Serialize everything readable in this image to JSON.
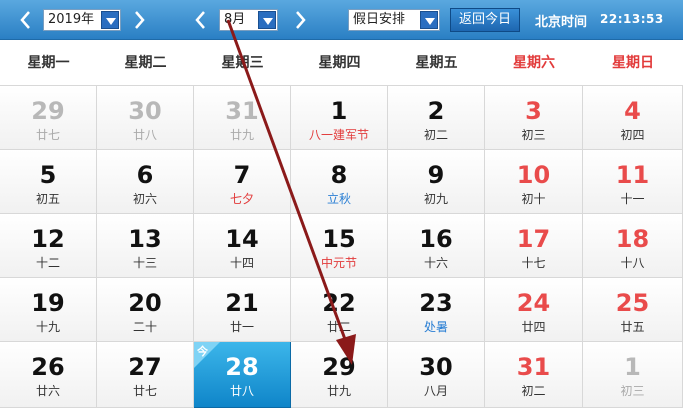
{
  "toolbar": {
    "year_value": "2019年",
    "month_value": "8月",
    "holiday_value": "假日安排",
    "today_button": "返回今日",
    "clock_label": "北京时间",
    "clock_time": "22:13:53"
  },
  "weekdays": [
    "星期一",
    "星期二",
    "星期三",
    "星期四",
    "星期五",
    "星期六",
    "星期日"
  ],
  "colors": {
    "weekend": "#e94b4b",
    "festival": "#e23b3b",
    "solar_term": "#2a7fd4",
    "today": "#1a9ad8",
    "arrow": "#8b1a1a"
  },
  "today_tag": "今",
  "weeks": [
    [
      {
        "day": "29",
        "lunar": "廿七",
        "other": true
      },
      {
        "day": "30",
        "lunar": "廿八",
        "other": true
      },
      {
        "day": "31",
        "lunar": "廿九",
        "other": true
      },
      {
        "day": "1",
        "lunar": "八一建军节",
        "type": "fest"
      },
      {
        "day": "2",
        "lunar": "初二"
      },
      {
        "day": "3",
        "lunar": "初三",
        "weekend": true
      },
      {
        "day": "4",
        "lunar": "初四",
        "weekend": true
      }
    ],
    [
      {
        "day": "5",
        "lunar": "初五"
      },
      {
        "day": "6",
        "lunar": "初六"
      },
      {
        "day": "7",
        "lunar": "七夕",
        "type": "fest"
      },
      {
        "day": "8",
        "lunar": "立秋",
        "type": "term"
      },
      {
        "day": "9",
        "lunar": "初九"
      },
      {
        "day": "10",
        "lunar": "初十",
        "weekend": true
      },
      {
        "day": "11",
        "lunar": "十一",
        "weekend": true
      }
    ],
    [
      {
        "day": "12",
        "lunar": "十二"
      },
      {
        "day": "13",
        "lunar": "十三"
      },
      {
        "day": "14",
        "lunar": "十四"
      },
      {
        "day": "15",
        "lunar": "中元节",
        "type": "fest"
      },
      {
        "day": "16",
        "lunar": "十六"
      },
      {
        "day": "17",
        "lunar": "十七",
        "weekend": true
      },
      {
        "day": "18",
        "lunar": "十八",
        "weekend": true
      }
    ],
    [
      {
        "day": "19",
        "lunar": "十九"
      },
      {
        "day": "20",
        "lunar": "二十"
      },
      {
        "day": "21",
        "lunar": "廿一"
      },
      {
        "day": "22",
        "lunar": "廿二"
      },
      {
        "day": "23",
        "lunar": "处暑",
        "type": "term"
      },
      {
        "day": "24",
        "lunar": "廿四",
        "weekend": true
      },
      {
        "day": "25",
        "lunar": "廿五",
        "weekend": true
      }
    ],
    [
      {
        "day": "26",
        "lunar": "廿六"
      },
      {
        "day": "27",
        "lunar": "廿七"
      },
      {
        "day": "28",
        "lunar": "廿八",
        "today": true
      },
      {
        "day": "29",
        "lunar": "廿九"
      },
      {
        "day": "30",
        "lunar": "八月"
      },
      {
        "day": "31",
        "lunar": "初二",
        "weekend": true
      },
      {
        "day": "1",
        "lunar": "初三",
        "other": true
      }
    ]
  ]
}
